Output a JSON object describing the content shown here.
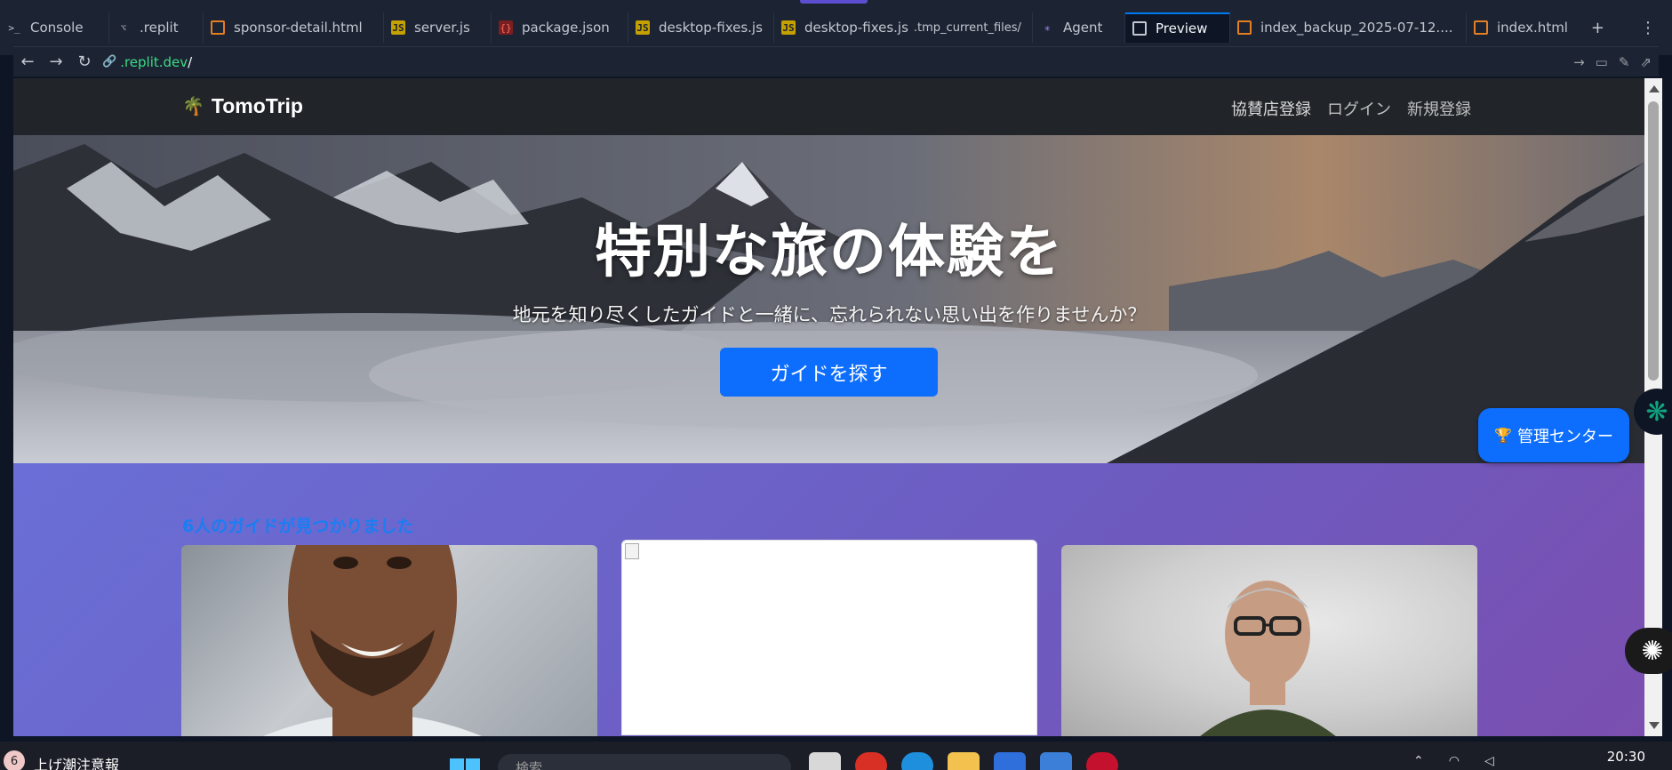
{
  "ide": {
    "tabs": [
      {
        "label": "Console",
        "icon": "console-icon",
        "active": false
      },
      {
        "label": ".replit",
        "icon": "config-icon",
        "active": false
      },
      {
        "label": "sponsor-detail.html",
        "icon": "html-file-icon",
        "active": false
      },
      {
        "label": "server.js",
        "icon": "js-file-icon",
        "active": false
      },
      {
        "label": "package.json",
        "icon": "json-file-icon",
        "active": false
      },
      {
        "label": "desktop-fixes.js",
        "icon": "js-file-icon",
        "active": false
      },
      {
        "label": "desktop-fixes.js",
        "sublabel": ".tmp_current_files/",
        "icon": "js-file-icon",
        "active": false
      },
      {
        "label": "Agent",
        "icon": "agent-icon",
        "active": false
      },
      {
        "label": "Preview",
        "icon": "preview-icon",
        "active": true
      },
      {
        "label": "index_backup_2025-07-12....",
        "icon": "html-file-icon",
        "active": false
      },
      {
        "label": "index.html",
        "icon": "html-file-icon",
        "active": false
      }
    ],
    "new_tab": "+",
    "more": "⋮",
    "url": {
      "domain": ".replit.dev",
      "path": "/"
    }
  },
  "site": {
    "brand": "TomoTrip",
    "brand_icon": "🌴",
    "nav_links": [
      "協賛店登録",
      "ログイン",
      "新規登録"
    ],
    "hero": {
      "title": "特別な旅の体験を",
      "subtitle": "地元を知り尽くしたガイドと一緒に、忘れられない思い出を作りませんか？",
      "button": "ガイドを探す"
    },
    "results_title": "6人のガイドが見つかりました",
    "admin_button": "管理センター",
    "admin_icon": "🏆"
  },
  "taskbar": {
    "badge": "6",
    "news": "上げ潮注意報",
    "search_placeholder": "検索",
    "clock": "20:30"
  },
  "colors": {
    "accent": "#0d6efd",
    "nav_bg": "#212529",
    "results_title": "#1a7ef2",
    "ide_bg": "#1c2333"
  }
}
